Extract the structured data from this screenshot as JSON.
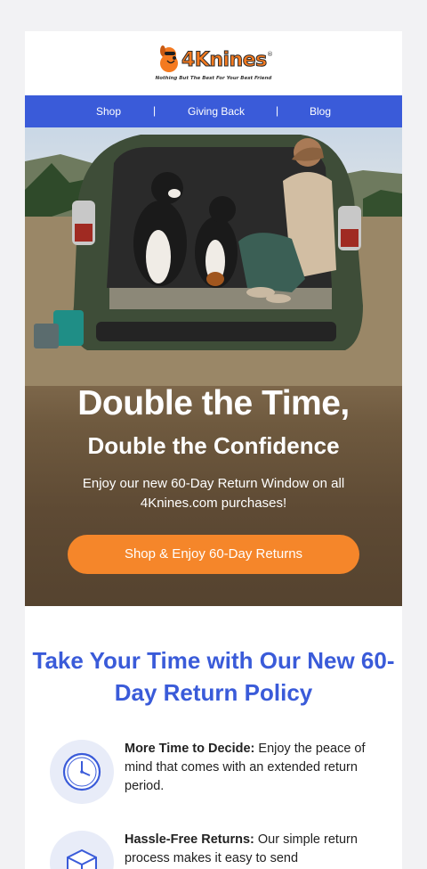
{
  "brand": {
    "name": "4Knines",
    "registered": "®",
    "tagline": "Nothing But The Best For Your Best Friend"
  },
  "nav": {
    "items": [
      "Shop",
      "Giving Back",
      "Blog"
    ],
    "separator": "|"
  },
  "hero": {
    "title_line1": "Double the Time,",
    "title_line2": "Double the Confidence",
    "subtitle": "Enjoy our new 60-Day Return Window on all 4Knines.com purchases!",
    "cta_label": "Shop & Enjoy 60-Day Returns"
  },
  "policy": {
    "title": "Take Your Time with Our New 60-Day Return Policy",
    "features": [
      {
        "icon": "clock-icon",
        "heading": "More Time to Decide:",
        "text": " Enjoy the peace of mind that comes with an extended return period."
      },
      {
        "icon": "package-icon",
        "heading": "Hassle-Free Returns:",
        "text": " Our simple return process makes it easy to send"
      }
    ]
  },
  "colors": {
    "brand_orange": "#f5862a",
    "nav_blue": "#3a5bd9",
    "heading_blue": "#3a5bd9"
  }
}
